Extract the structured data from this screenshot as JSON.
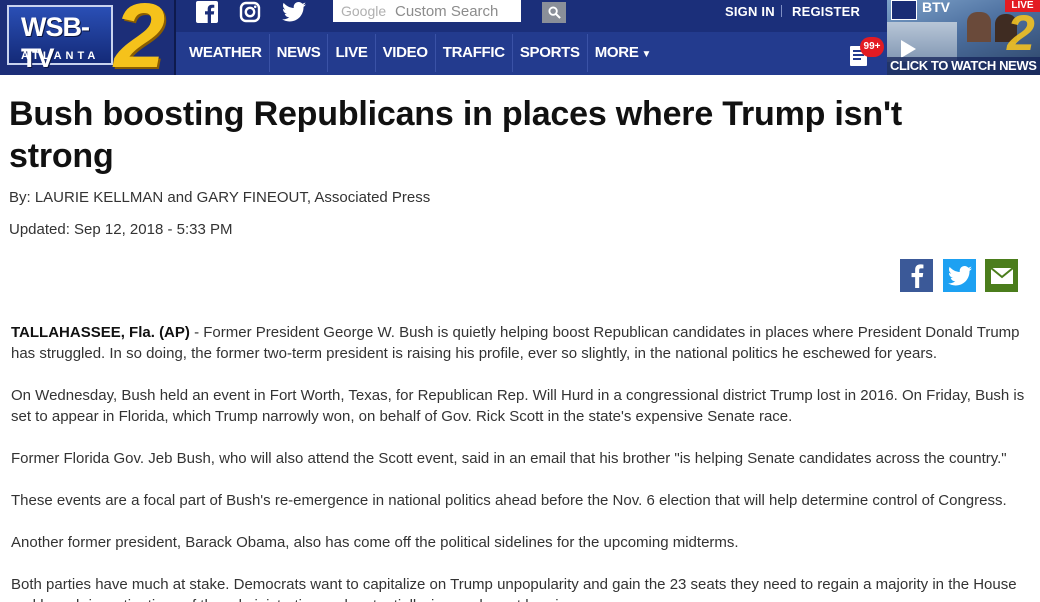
{
  "site": {
    "logo_text": "WSB-TV",
    "logo_city": "ATLANTA",
    "logo_number": "2"
  },
  "header": {
    "search": {
      "brand": "Google",
      "placeholder": "Custom Search"
    },
    "account": {
      "sign_in": "SIGN IN",
      "register": "REGISTER"
    },
    "nav": [
      "WEATHER",
      "NEWS",
      "LIVE",
      "VIDEO",
      "TRAFFIC",
      "SPORTS",
      "MORE"
    ],
    "notifications_badge": "99+",
    "live_video": {
      "brand": "BTV",
      "live_label": "LIVE",
      "caption": "CLICK TO WATCH NEWS"
    }
  },
  "article": {
    "headline": "Bush boosting Republicans in places where Trump isn't strong",
    "byline": "By: LAURIE KELLMAN and GARY FINEOUT, Associated Press",
    "updated": "Updated: Sep 12, 2018 - 5:33 PM",
    "dateline": "TALLAHASSEE, Fla. (AP)",
    "paragraphs": [
      " - Former President George W. Bush is quietly helping boost Republican candidates in places where President Donald Trump has struggled. In so doing, the former two-term president is raising his profile, ever so slightly, in the national politics he eschewed for years.",
      "On Wednesday, Bush held an event in Fort Worth, Texas, for Republican Rep. Will Hurd in a congressional district Trump lost in 2016. On Friday, Bush is set to appear in Florida, which Trump narrowly won, on behalf of Gov. Rick Scott in the state's expensive Senate race.",
      "Former Florida Gov. Jeb Bush, who will also attend the Scott event, said in an email that his brother \"is helping Senate candidates across the country.\"",
      "These events are a focal part of Bush's re-emergence in national politics ahead before the Nov. 6 election that will help determine control of Congress.",
      "Another former president, Barack Obama, also has come off the political sidelines for the upcoming midterms.",
      "Both parties have much at stake. Democrats want to capitalize on Trump unpopularity and gain the 23 seats they need to regain a majority in the House and launch investigations of the administration and, potentially, impeachment hearings."
    ]
  },
  "colors": {
    "header_bg": "#1b2f7a",
    "nav_bg": "#233b8e",
    "badge_red": "#e31b23",
    "facebook": "#3b5998",
    "twitter": "#1da1f2",
    "email": "#4b7d1c"
  },
  "icons": [
    "facebook-icon",
    "instagram-icon",
    "twitter-icon",
    "search-icon",
    "notifications-icon",
    "play-icon",
    "email-icon"
  ]
}
